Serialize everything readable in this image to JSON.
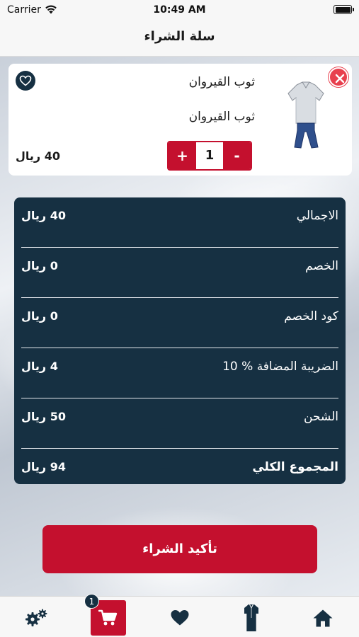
{
  "status_bar": {
    "carrier": "Carrier",
    "time": "10:49 AM"
  },
  "nav": {
    "title": "سلة الشراء"
  },
  "cart_item": {
    "title": "ثوب القيروان",
    "subtitle": "ثوب القيروان",
    "price": "40 ريال",
    "quantity": "1",
    "plus_label": "+",
    "minus_label": "-"
  },
  "summary": {
    "rows": [
      {
        "label": "الاجمالي",
        "value": "40 ريال"
      },
      {
        "label": "الخصم",
        "value": "0 ريال"
      },
      {
        "label": "كود الخصم",
        "value": "0 ريال"
      },
      {
        "label": "الضريبة المضافة % 10",
        "value": "4 ريال"
      },
      {
        "label": "الشحن",
        "value": "50 ريال"
      },
      {
        "label": "المجموع الكلي",
        "value": "94 ريال"
      }
    ]
  },
  "confirm": {
    "label": "تأكيد الشراء"
  },
  "tabbar": {
    "cart_badge": "1"
  },
  "colors": {
    "accent": "#c4102e",
    "navy": "#163042",
    "remove": "#e8404e"
  },
  "icons": [
    "wifi-icon",
    "battery-icon",
    "close-icon",
    "heart-icon",
    "product-image",
    "gear-icon",
    "cart-icon",
    "thobe-icon",
    "home-icon"
  ]
}
